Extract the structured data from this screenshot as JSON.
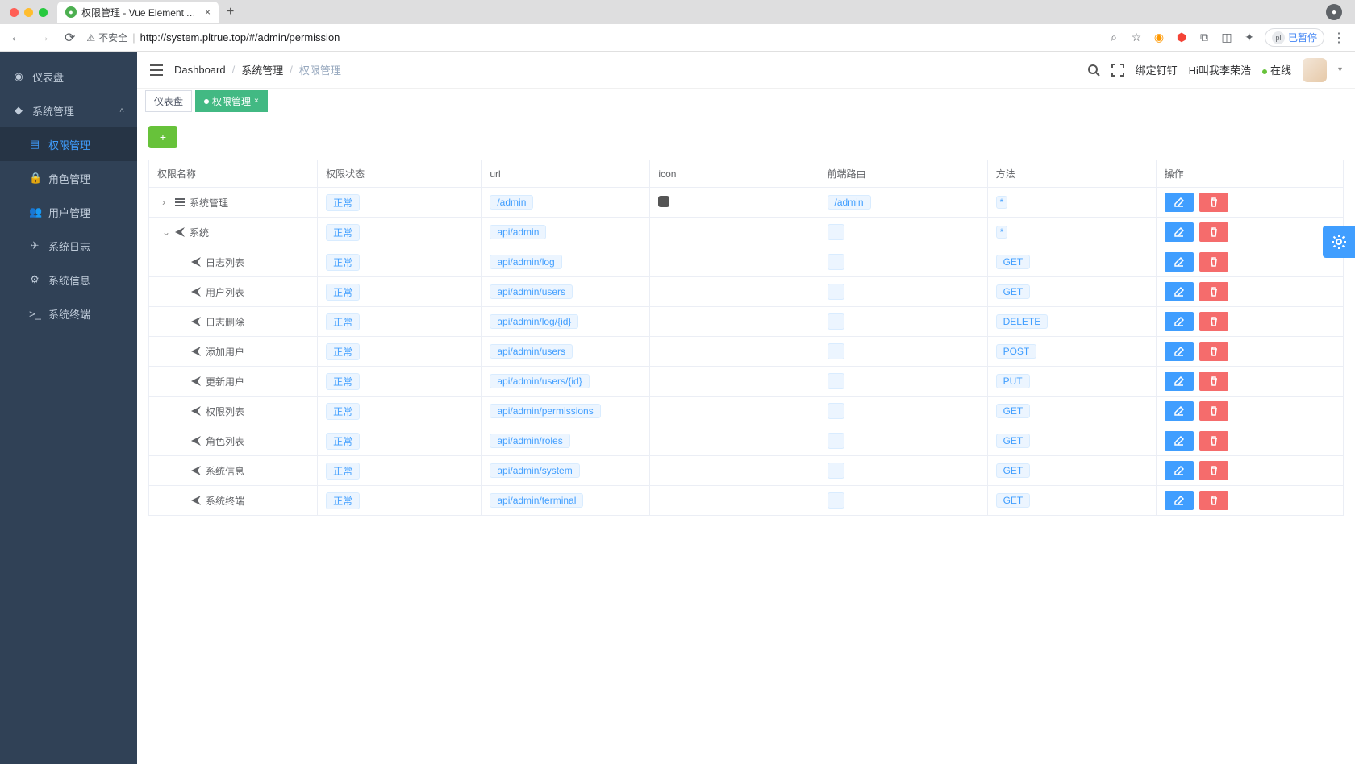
{
  "browser": {
    "tab_title": "权限管理 - Vue Element Admin",
    "url": "http://system.pltrue.top/#/admin/permission",
    "not_secure": "不安全",
    "pause_label": "已暂停",
    "pause_badge_abbr": "pl"
  },
  "sidebar": {
    "items": [
      {
        "icon": "tachometer",
        "label": "仪表盘",
        "expandable": false
      },
      {
        "icon": "cog",
        "label": "系统管理",
        "expandable": true,
        "open": true,
        "children": [
          {
            "icon": "list",
            "label": "权限管理",
            "active": true
          },
          {
            "icon": "lock",
            "label": "角色管理"
          },
          {
            "icon": "users",
            "label": "用户管理"
          },
          {
            "icon": "paper-plane",
            "label": "系统日志"
          },
          {
            "icon": "gear",
            "label": "系统信息"
          },
          {
            "icon": "terminal",
            "label": "系统终端"
          }
        ]
      }
    ]
  },
  "header": {
    "breadcrumb": [
      "Dashboard",
      "系统管理",
      "权限管理"
    ],
    "bind_dingding": "绑定钉钉",
    "user_greeting": "Hi叫我李荣浩",
    "online": "在线"
  },
  "tabsview": {
    "tabs": [
      {
        "label": "仪表盘",
        "active": false
      },
      {
        "label": "权限管理",
        "active": true
      }
    ]
  },
  "table": {
    "headers": {
      "name": "权限名称",
      "status": "权限状态",
      "url": "url",
      "icon": "icon",
      "route": "前端路由",
      "method": "方法",
      "action": "操作"
    },
    "rows": [
      {
        "indent": 0,
        "expander": ">",
        "icon": "bars",
        "name": "系统管理",
        "status": "正常",
        "url": "/admin",
        "has_icon": true,
        "route": "/admin",
        "method": "*"
      },
      {
        "indent": 0,
        "expander": "v",
        "icon": "paper-plane",
        "name": "系统",
        "status": "正常",
        "url": "api/admin",
        "has_icon": false,
        "route": "",
        "method": "*"
      },
      {
        "indent": 1,
        "expander": "",
        "icon": "paper-plane",
        "name": "日志列表",
        "status": "正常",
        "url": "api/admin/log",
        "has_icon": false,
        "route": "",
        "method": "GET"
      },
      {
        "indent": 1,
        "expander": "",
        "icon": "paper-plane",
        "name": "用户列表",
        "status": "正常",
        "url": "api/admin/users",
        "has_icon": false,
        "route": "",
        "method": "GET"
      },
      {
        "indent": 1,
        "expander": "",
        "icon": "paper-plane",
        "name": "日志删除",
        "status": "正常",
        "url": "api/admin/log/{id}",
        "has_icon": false,
        "route": "",
        "method": "DELETE"
      },
      {
        "indent": 1,
        "expander": "",
        "icon": "paper-plane",
        "name": "添加用户",
        "status": "正常",
        "url": "api/admin/users",
        "has_icon": false,
        "route": "",
        "method": "POST"
      },
      {
        "indent": 1,
        "expander": "",
        "icon": "paper-plane",
        "name": "更新用户",
        "status": "正常",
        "url": "api/admin/users/{id}",
        "has_icon": false,
        "route": "",
        "method": "PUT"
      },
      {
        "indent": 1,
        "expander": "",
        "icon": "paper-plane",
        "name": "权限列表",
        "status": "正常",
        "url": "api/admin/permissions",
        "has_icon": false,
        "route": "",
        "method": "GET"
      },
      {
        "indent": 1,
        "expander": "",
        "icon": "paper-plane",
        "name": "角色列表",
        "status": "正常",
        "url": "api/admin/roles",
        "has_icon": false,
        "route": "",
        "method": "GET"
      },
      {
        "indent": 1,
        "expander": "",
        "icon": "paper-plane",
        "name": "系统信息",
        "status": "正常",
        "url": "api/admin/system",
        "has_icon": false,
        "route": "",
        "method": "GET"
      },
      {
        "indent": 1,
        "expander": "",
        "icon": "paper-plane",
        "name": "系统终端",
        "status": "正常",
        "url": "api/admin/terminal",
        "has_icon": false,
        "route": "",
        "method": "GET"
      }
    ]
  }
}
